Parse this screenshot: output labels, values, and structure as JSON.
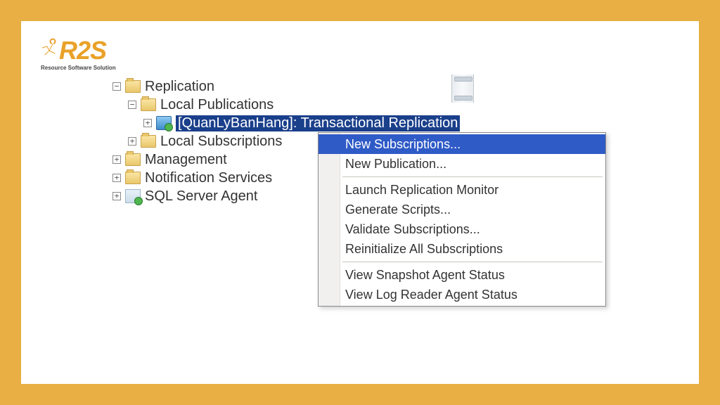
{
  "logo": {
    "text": "R2S",
    "tagline": "Resource Software Solution"
  },
  "tree": {
    "nodes": [
      {
        "indent": 0,
        "toggle": "-",
        "icon": "folder",
        "label": "Replication",
        "selected": false
      },
      {
        "indent": 1,
        "toggle": "-",
        "icon": "folder",
        "label": "Local Publications",
        "selected": false
      },
      {
        "indent": 2,
        "toggle": "+",
        "icon": "publication",
        "label": "[QuanLyBanHang]: Transactional Replication",
        "selected": true
      },
      {
        "indent": 1,
        "toggle": "+",
        "icon": "folder",
        "label": "Local Subscriptions",
        "selected": false
      },
      {
        "indent": 0,
        "toggle": "+",
        "icon": "folder",
        "label": "Management",
        "selected": false
      },
      {
        "indent": 0,
        "toggle": "+",
        "icon": "folder",
        "label": "Notification Services",
        "selected": false
      },
      {
        "indent": 0,
        "toggle": "+",
        "icon": "agent",
        "label": "SQL Server Agent",
        "selected": false
      }
    ]
  },
  "context_menu": {
    "groups": [
      [
        {
          "label": "New Subscriptions...",
          "selected": true
        },
        {
          "label": "New Publication...",
          "selected": false
        }
      ],
      [
        {
          "label": "Launch Replication Monitor",
          "selected": false
        },
        {
          "label": "Generate Scripts...",
          "selected": false
        },
        {
          "label": "Validate Subscriptions...",
          "selected": false
        },
        {
          "label": "Reinitialize All Subscriptions",
          "selected": false
        }
      ],
      [
        {
          "label": "View Snapshot Agent Status",
          "selected": false
        },
        {
          "label": "View Log Reader Agent Status",
          "selected": false
        }
      ]
    ]
  }
}
